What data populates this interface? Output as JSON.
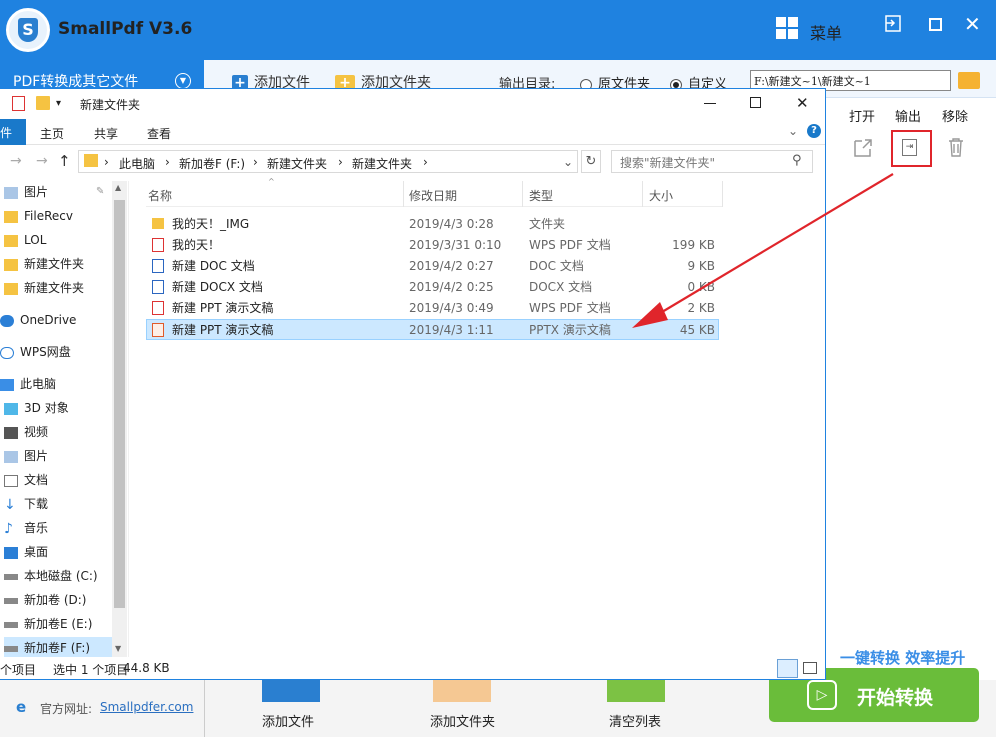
{
  "app": {
    "name": "SmallPdf V3.6",
    "menu_label": "菜单",
    "mode_label": "PDF转换成其它文件",
    "add_file": "添加文件",
    "add_folder": "添加文件夹",
    "outdir_label": "输出目录:",
    "radio_source": "原文件夹",
    "radio_custom": "自定义",
    "output_path": "F:\\新建文~1\\新建文~1",
    "columns": {
      "open": "打开",
      "output": "输出",
      "remove": "移除"
    },
    "slogan": "一键转换  效率提升",
    "website_label": "官方网址:",
    "website_link": "Smallpdfer.com",
    "bottom_add_file": "添加文件",
    "bottom_add_folder": "添加文件夹",
    "bottom_clear": "清空列表",
    "start_button": "开始转换",
    "accent": "#1f82e0",
    "start_color": "#6abd3a"
  },
  "explorer": {
    "window_title": "新建文件夹",
    "tabs": {
      "file": "件",
      "home": "主页",
      "share": "共享",
      "view": "查看"
    },
    "breadcrumb": [
      "此电脑",
      "新加卷F (F:)",
      "新建文件夹",
      "新建文件夹"
    ],
    "search_placeholder": "搜索\"新建文件夹\"",
    "nav": [
      "图片",
      "FileRecv",
      "LOL",
      "新建文件夹",
      "新建文件夹",
      "OneDrive",
      "WPS网盘",
      "此电脑",
      "3D 对象",
      "视频",
      "图片",
      "文档",
      "下载",
      "音乐",
      "桌面",
      "本地磁盘 (C:)",
      "新加卷 (D:)",
      "新加卷E (E:)",
      "新加卷F (F:)"
    ],
    "headers": {
      "name": "名称",
      "date": "修改日期",
      "type": "类型",
      "size": "大小"
    },
    "files": [
      {
        "name": "我的天！_IMG",
        "date": "2019/4/3 0:28",
        "type": "文件夹",
        "size": ""
      },
      {
        "name": "我的天！",
        "date": "2019/3/31 0:10",
        "type": "WPS PDF 文档",
        "size": "199 KB"
      },
      {
        "name": "新建 DOC 文档",
        "date": "2019/4/2 0:27",
        "type": "DOC 文档",
        "size": "9 KB"
      },
      {
        "name": "新建 DOCX 文档",
        "date": "2019/4/2 0:25",
        "type": "DOCX 文档",
        "size": "0 KB"
      },
      {
        "name": "新建 PPT 演示文稿",
        "date": "2019/4/3 0:49",
        "type": "WPS PDF 文档",
        "size": "2 KB"
      },
      {
        "name": "新建 PPT 演示文稿",
        "date": "2019/4/3 1:11",
        "type": "PPTX 演示文稿",
        "size": "45 KB"
      }
    ],
    "status": {
      "count": "个项目",
      "selected": "选中 1 个项目",
      "size": "44.8 KB"
    }
  }
}
